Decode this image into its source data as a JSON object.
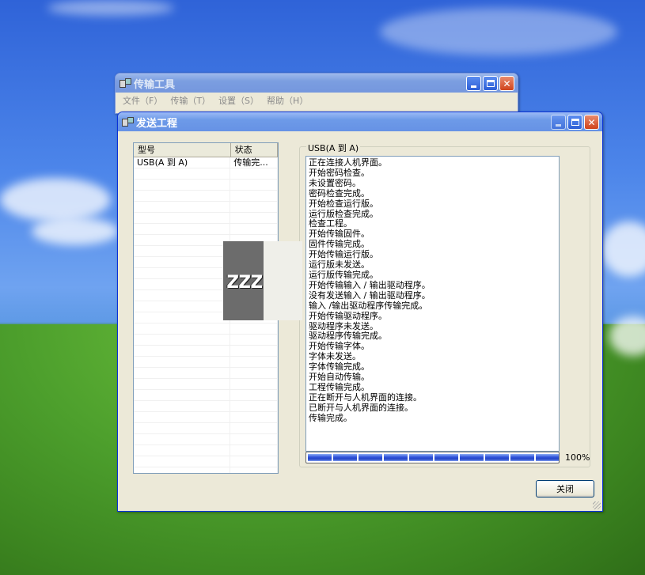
{
  "back_window": {
    "title": "传输工具",
    "menu": [
      "文件（F）",
      "传输（T）",
      "设置（S）",
      "帮助（H）"
    ]
  },
  "dialog": {
    "title": "发送工程",
    "list": {
      "columns": [
        "型号",
        "状态"
      ],
      "rows": [
        {
          "model": "USB(A 到 A)",
          "status": "传输完..."
        }
      ]
    },
    "group_label": "USB(A 到 A)",
    "log": [
      "正在连接人机界面。",
      "开始密码检查。",
      "未设置密码。",
      "密码检查完成。",
      "开始检查运行版。",
      "运行版检查完成。",
      "检查工程。",
      "开始传输固件。",
      "固件传输完成。",
      "开始传输运行版。",
      "运行版未发送。",
      "运行版传输完成。",
      "开始传输输入 / 输出驱动程序。",
      "没有发送输入 / 输出驱动程序。",
      "输入 /输出驱动程序传输完成。",
      "开始传输驱动程序。",
      "驱动程序未发送。",
      "驱动程序传输完成。",
      "开始传输字体。",
      "字体未发送。",
      "字体传输完成。",
      "开始自动传输。",
      "工程传输完成。",
      "正在断开与人机界面的连接。",
      "已断开与人机界面的连接。",
      "传输完成。"
    ],
    "progress": {
      "percent": 1.0,
      "label": "100%",
      "segments": 10
    },
    "close_button": "关闭"
  },
  "overlay": {
    "text": "zzz"
  }
}
